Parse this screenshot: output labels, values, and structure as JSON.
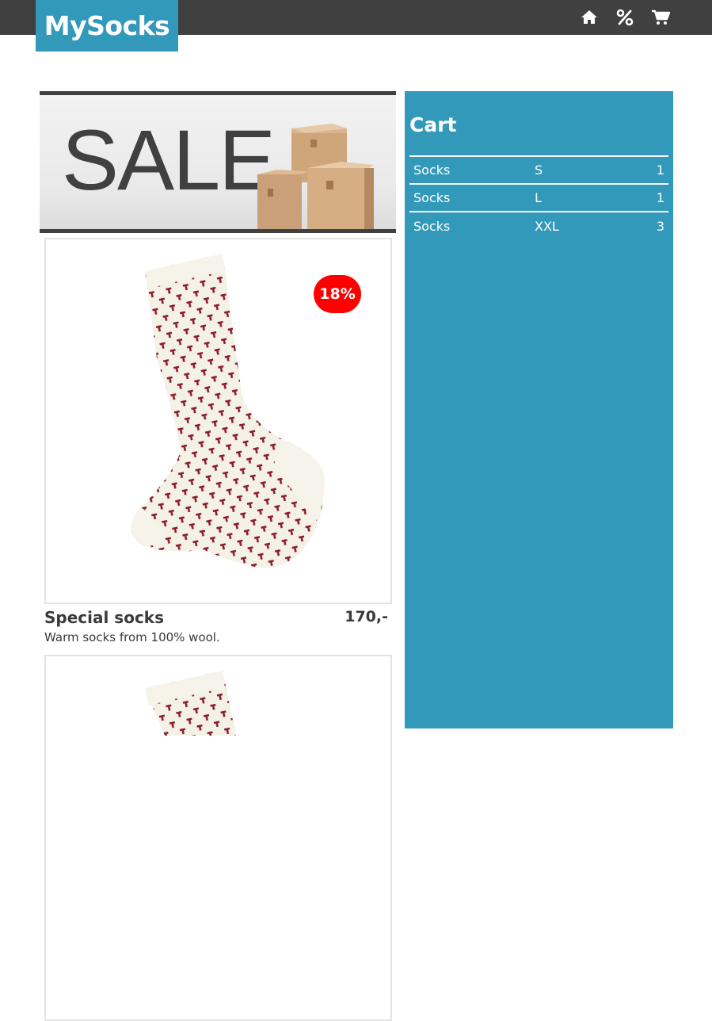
{
  "header": {
    "logo": "MySocks",
    "nav": [
      {
        "icon": "home-icon"
      },
      {
        "icon": "percent-icon"
      },
      {
        "icon": "cart-icon"
      }
    ]
  },
  "banner": {
    "text": "SALE"
  },
  "products": [
    {
      "name": "Special socks",
      "price": "170,-",
      "description": "Warm socks from 100% wool.",
      "discount": "18%"
    }
  ],
  "cart": {
    "title": "Cart",
    "items": [
      {
        "name": "Socks",
        "size": "S",
        "qty": "1"
      },
      {
        "name": "Socks",
        "size": "L",
        "qty": "1"
      },
      {
        "name": "Socks",
        "size": "XXL",
        "qty": "3"
      }
    ]
  },
  "colors": {
    "accent": "#3399bb",
    "topbar": "#404040",
    "badge": "#ff0000",
    "sock_body": "#f4f1e6",
    "sock_pattern": "#8e1b2c"
  }
}
